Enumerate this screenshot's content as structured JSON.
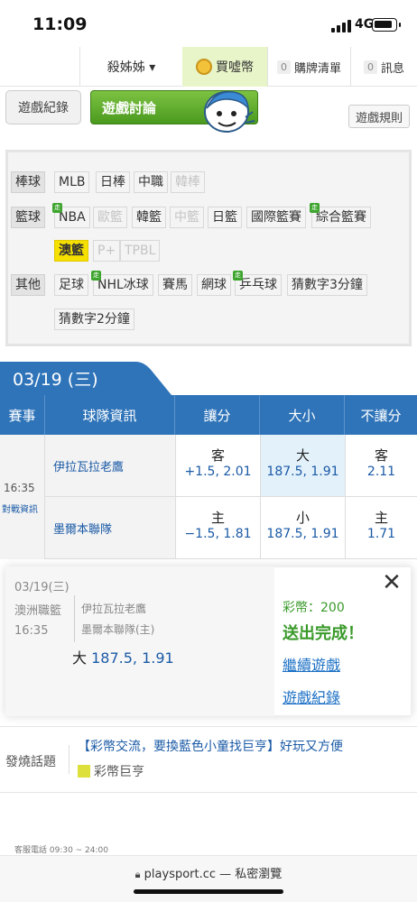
{
  "status_bar": {
    "time": "11:09",
    "network": "4G"
  },
  "nav": {
    "user": "殺姊姊 ▾",
    "buy": "買噓幣",
    "cart_count": "0",
    "cart": "購牌清單",
    "msg_count": "0",
    "msg": "訊息"
  },
  "tabs": {
    "record": "遊戲紀錄",
    "discuss": "遊戲討論",
    "rules": "遊戲規則"
  },
  "categories": {
    "baseball": {
      "label": "棒球",
      "items": [
        "MLB",
        "日棒",
        "中職",
        "韓棒"
      ]
    },
    "basketball": {
      "label": "籃球",
      "items": [
        "NBA",
        "歐籃",
        "韓籃",
        "中籃",
        "日籃",
        "國際籃賽",
        "綜合籃賽",
        "澳籃",
        "P+",
        "TPBL"
      ]
    },
    "other": {
      "label": "其他",
      "items": [
        "足球",
        "NHL冰球",
        "賽馬",
        "網球",
        "乒乓球",
        "猜數字3分鐘",
        "猜數字2分鐘"
      ]
    },
    "badge": "走"
  },
  "date_tab": "03/19 (三)",
  "table": {
    "headers": [
      "賽事",
      "球隊資訊",
      "讓分",
      "大小",
      "不讓分"
    ],
    "match_time": "16:35",
    "match_info": "對戰資訊",
    "teams": [
      "伊拉瓦拉老鷹",
      "墨爾本聯隊"
    ],
    "rows": [
      {
        "spread_label": "客",
        "spread_odds": "+1.5, 2.01",
        "total_label": "大",
        "total_odds": "187.5, 1.91",
        "ml_label": "客",
        "ml_odds": "2.11"
      },
      {
        "spread_label": "主",
        "spread_odds": "−1.5, 1.81",
        "total_label": "小",
        "total_odds": "187.5, 1.91",
        "ml_label": "主",
        "ml_odds": "1.71"
      }
    ]
  },
  "popup": {
    "date": "03/19(三)",
    "league": "澳洲職籃",
    "time": "16:35",
    "away": "伊拉瓦拉老鷹",
    "home": "墨爾本聯隊(主)",
    "pick_label": "大",
    "pick_odds": "187.5, 1.91",
    "coins": "彩幣：200",
    "sent": "送出完成！",
    "continue": "繼續遊戲",
    "record": "遊戲紀錄",
    "close": "✕"
  },
  "hot_topic": {
    "label": "發燒話題",
    "title": "【彩幣交流，要換藍色小童找巨亨】好玩又方便",
    "author": "彩幣巨亨"
  },
  "footnote": "客服電話 09:30 ~ 24:00",
  "browser": {
    "url": "playsport.cc — 私密瀏覽"
  }
}
